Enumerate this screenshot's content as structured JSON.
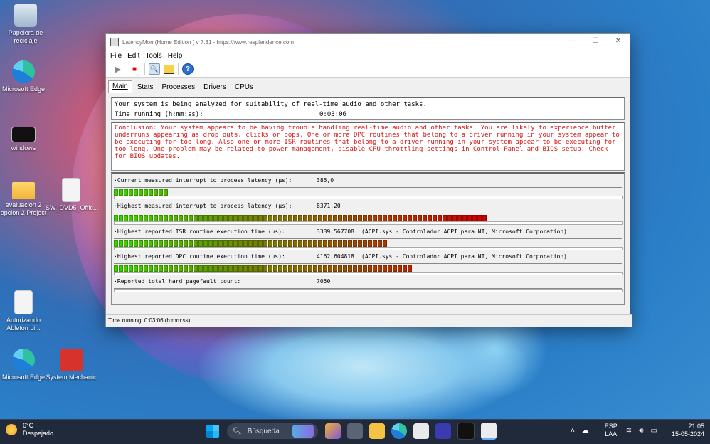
{
  "desktop": {
    "icons": [
      {
        "label": "Papelera de reciclaje"
      },
      {
        "label": "Microsoft Edge"
      },
      {
        "label": "windows"
      },
      {
        "label": "evaluacion 2 opcion 2 Project"
      },
      {
        "label": "SW_DVD5_Offic..."
      },
      {
        "label": "Autorizando Ableton Li..."
      },
      {
        "label": "Microsoft Edge"
      },
      {
        "label": "System Mechanic"
      }
    ]
  },
  "window": {
    "title": "LatencyMon  (Home Edition )  v 7.31 - https://www.resplendence.com",
    "controls": {
      "minimize": "—",
      "maximize": "☐",
      "close": "✕"
    },
    "menu": [
      "File",
      "Edit",
      "Tools",
      "Help"
    ],
    "toolbar": {
      "play": "▶",
      "stop": "■",
      "help": "?"
    },
    "tabs": [
      "Main",
      "Stats",
      "Processes",
      "Drivers",
      "CPUs"
    ],
    "analysis": {
      "line1": "Your system is being analyzed for suitability of real-time audio and other tasks.",
      "time_label": "Time running (h:mm:ss):",
      "time_value": "0:03:06"
    },
    "conclusion": "Conclusion: Your system appears to be having trouble handling real-time audio and other tasks. You are likely to experience buffer underruns appearing as drop outs, clicks or pops. One or more DPC routines that belong to a driver running in your system appear to be executing for too long. Also one or more ISR routines that belong to a driver running in your system appear to be executing for too long. One problem may be related to power management, disable CPU throttling settings in Control Panel and BIOS setup. Check for BIOS updates.",
    "metrics": [
      {
        "label": "·Current measured interrupt to process latency (µs):",
        "value": "385,0",
        "desc": "",
        "level": 0.112
      },
      {
        "label": "·Highest measured interrupt to process latency (µs):",
        "value": "8371,20",
        "desc": "",
        "level": 0.735
      },
      {
        "label": "·Highest reported ISR routine execution time (µs):",
        "value": "3339,567708",
        "desc": "(ACPI.sys - Controlador ACPI para NT, Microsoft Corporation)",
        "level": 0.537
      },
      {
        "label": "·Highest reported DPC routine execution time (µs):",
        "value": "4162,604818",
        "desc": "(ACPI.sys - Controlador ACPI para NT, Microsoft Corporation)",
        "level": 0.584
      },
      {
        "label": "·Reported total hard pagefault count:",
        "value": "7050",
        "desc": "",
        "level": 0
      }
    ],
    "status": "Time running: 0:03:06  (h:mm:ss)"
  },
  "taskbar": {
    "weather": {
      "temp": "6°C",
      "desc": "Despejado"
    },
    "search_placeholder": "Búsqueda",
    "tray": {
      "lang1": "ESP",
      "lang2": "LAA",
      "time": "21:05",
      "date": "15-05-2024"
    }
  },
  "colors": {
    "green": "#3cd400",
    "red": "#d10000",
    "conclusion_text": "#d61515"
  }
}
